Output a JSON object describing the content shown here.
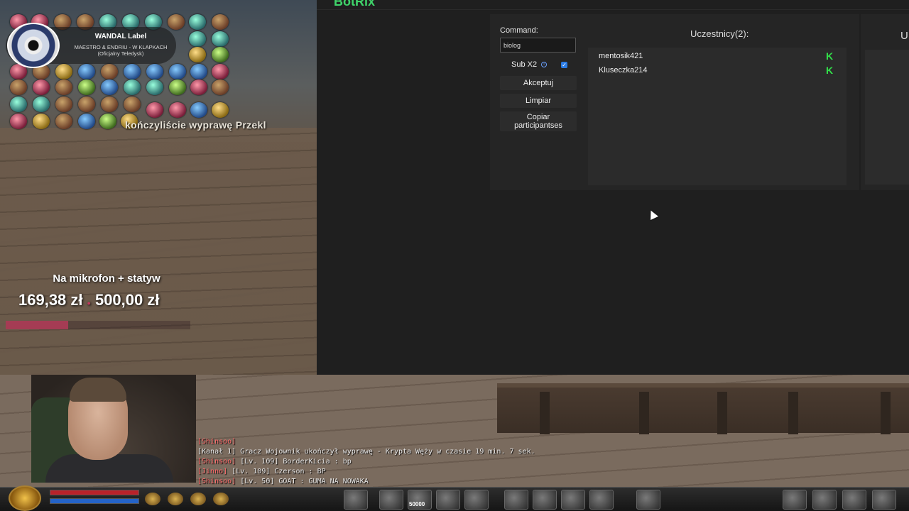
{
  "app": {
    "logo": "BotRix",
    "command_label": "Command:",
    "command_value": "biolog",
    "sub_label": "Sub X2",
    "sub_checked": true,
    "accept_label": "Akceptuj",
    "clear_label": "Limpiar",
    "copy_label": "Copiar participantses",
    "participants_title": "Uczestnicy(2):",
    "participants": [
      {
        "name": "mentosik421"
      },
      {
        "name": "Kluseczka214"
      }
    ],
    "right_panel_letter": "U",
    "kick_color": "#32e04a",
    "accent": "#3fd46a"
  },
  "overlay": {
    "music_title": "WANDAL Label",
    "music_sub": "MAESTRO & ENDRIU - W KLAPKACH (Oficjalny Teledysk)",
    "system_message": "kończyliście wyprawę Przekl",
    "goal_label": "Na mikrofon + statyw",
    "goal_current": "169,38 zł",
    "goal_target": "500,00 zł",
    "goal_progress": 0.34,
    "goal_color": "#c0395e"
  },
  "chat": [
    {
      "tag": "[Shinsoo]",
      "text": ""
    },
    {
      "tag": "",
      "text": "[Kanał 1] Gracz Wojownik ukończył wyprawę - Krypta Węży w czasie 19 min. 7 sek."
    },
    {
      "tag": "[Shinsoo]",
      "text": " [Lv. 109] BorderKicia : bp"
    },
    {
      "tag": "[Jinno]",
      "text": " [Lv. 109] Czerson : BP"
    },
    {
      "tag": "[Shinsoo]",
      "text": " [Lv. 50] GOAT :  GUMA NA NOWAKA"
    }
  ],
  "hotbar": {
    "counter": "50000"
  }
}
